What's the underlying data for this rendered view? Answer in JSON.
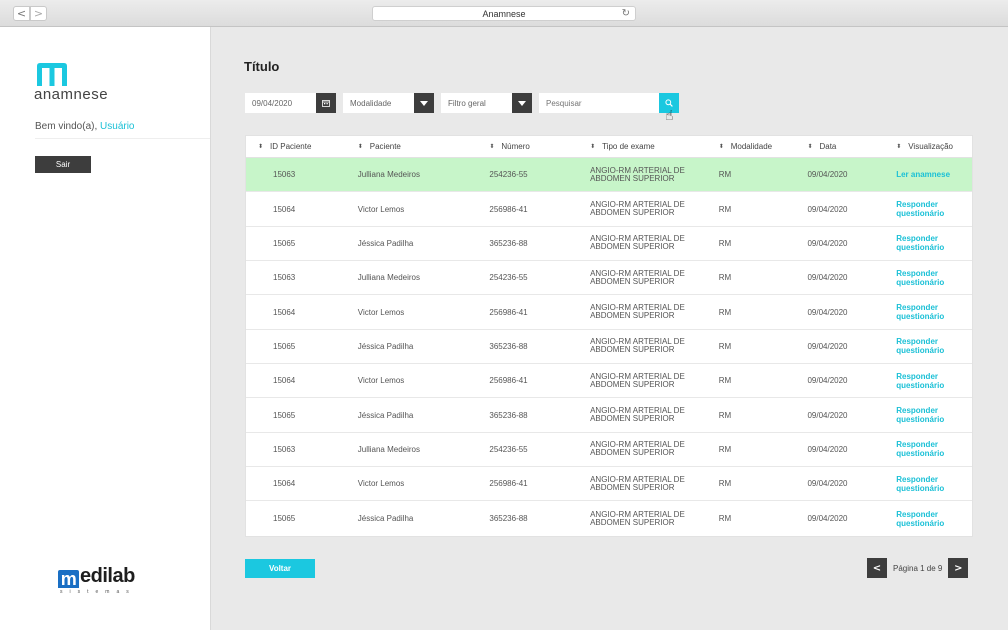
{
  "browser": {
    "url_title": "Anamnese",
    "back_icon": "<",
    "forward_icon": ">",
    "reload_icon": "↻"
  },
  "sidebar": {
    "logo_text": "anamnese",
    "welcome_text": "Bem vindo(a), ",
    "user_name": "Usuário",
    "logout_label": "Sair",
    "brand_name": "edilab",
    "brand_initial": "m",
    "brand_sub": "sistemas"
  },
  "main": {
    "title": "Título",
    "filters": {
      "date_value": "09/04/2020",
      "modalidade_label": "Modalidade",
      "filtro_label": "Filtro geral",
      "search_placeholder": "Pesquisar"
    },
    "table": {
      "columns": [
        "ID Paciente",
        "Paciente",
        "Número",
        "Tipo de exame",
        "Modalidade",
        "Data",
        "Visualização"
      ],
      "rows": [
        {
          "id": "15063",
          "paciente": "Julliana Medeiros",
          "numero": "254236-55",
          "tipo": "ANGIO-RM ARTERIAL DE ABDOMEN SUPERIOR",
          "modalidade": "RM",
          "data": "09/04/2020",
          "acao": "Ler anamnese",
          "active": true
        },
        {
          "id": "15064",
          "paciente": "Victor Lemos",
          "numero": "256986-41",
          "tipo": "ANGIO-RM ARTERIAL DE ABDOMEN SUPERIOR",
          "modalidade": "RM",
          "data": "09/04/2020",
          "acao": "Responder questionário",
          "active": false
        },
        {
          "id": "15065",
          "paciente": "Jéssica Padilha",
          "numero": "365236-88",
          "tipo": "ANGIO-RM ARTERIAL DE ABDOMEN SUPERIOR",
          "modalidade": "RM",
          "data": "09/04/2020",
          "acao": "Responder questionário",
          "active": false
        },
        {
          "id": "15063",
          "paciente": "Julliana Medeiros",
          "numero": "254236-55",
          "tipo": "ANGIO-RM ARTERIAL DE ABDOMEN SUPERIOR",
          "modalidade": "RM",
          "data": "09/04/2020",
          "acao": "Responder questionário",
          "active": false
        },
        {
          "id": "15064",
          "paciente": "Victor Lemos",
          "numero": "256986-41",
          "tipo": "ANGIO-RM ARTERIAL DE ABDOMEN SUPERIOR",
          "modalidade": "RM",
          "data": "09/04/2020",
          "acao": "Responder questionário",
          "active": false
        },
        {
          "id": "15065",
          "paciente": "Jéssica Padilha",
          "numero": "365236-88",
          "tipo": "ANGIO-RM ARTERIAL DE ABDOMEN SUPERIOR",
          "modalidade": "RM",
          "data": "09/04/2020",
          "acao": "Responder questionário",
          "active": false
        },
        {
          "id": "15064",
          "paciente": "Victor Lemos",
          "numero": "256986-41",
          "tipo": "ANGIO-RM ARTERIAL DE ABDOMEN SUPERIOR",
          "modalidade": "RM",
          "data": "09/04/2020",
          "acao": "Responder questionário",
          "active": false
        },
        {
          "id": "15065",
          "paciente": "Jéssica Padilha",
          "numero": "365236-88",
          "tipo": "ANGIO-RM ARTERIAL DE ABDOMEN SUPERIOR",
          "modalidade": "RM",
          "data": "09/04/2020",
          "acao": "Responder questionário",
          "active": false
        },
        {
          "id": "15063",
          "paciente": "Julliana Medeiros",
          "numero": "254236-55",
          "tipo": "ANGIO-RM ARTERIAL DE ABDOMEN SUPERIOR",
          "modalidade": "RM",
          "data": "09/04/2020",
          "acao": "Responder questionário",
          "active": false
        },
        {
          "id": "15064",
          "paciente": "Victor Lemos",
          "numero": "256986-41",
          "tipo": "ANGIO-RM ARTERIAL DE ABDOMEN SUPERIOR",
          "modalidade": "RM",
          "data": "09/04/2020",
          "acao": "Responder questionário",
          "active": false
        },
        {
          "id": "15065",
          "paciente": "Jéssica Padilha",
          "numero": "365236-88",
          "tipo": "ANGIO-RM ARTERIAL DE ABDOMEN SUPERIOR",
          "modalidade": "RM",
          "data": "09/04/2020",
          "acao": "Responder questionário",
          "active": false
        }
      ]
    },
    "back_label": "Voltar",
    "pagination": {
      "label": "Página 1 de 9",
      "prev_icon": "<",
      "next_icon": ">"
    }
  },
  "colors": {
    "accent": "#1bc8e0",
    "active_row": "#c7f5c9",
    "dark_button": "#3d3d3d"
  }
}
